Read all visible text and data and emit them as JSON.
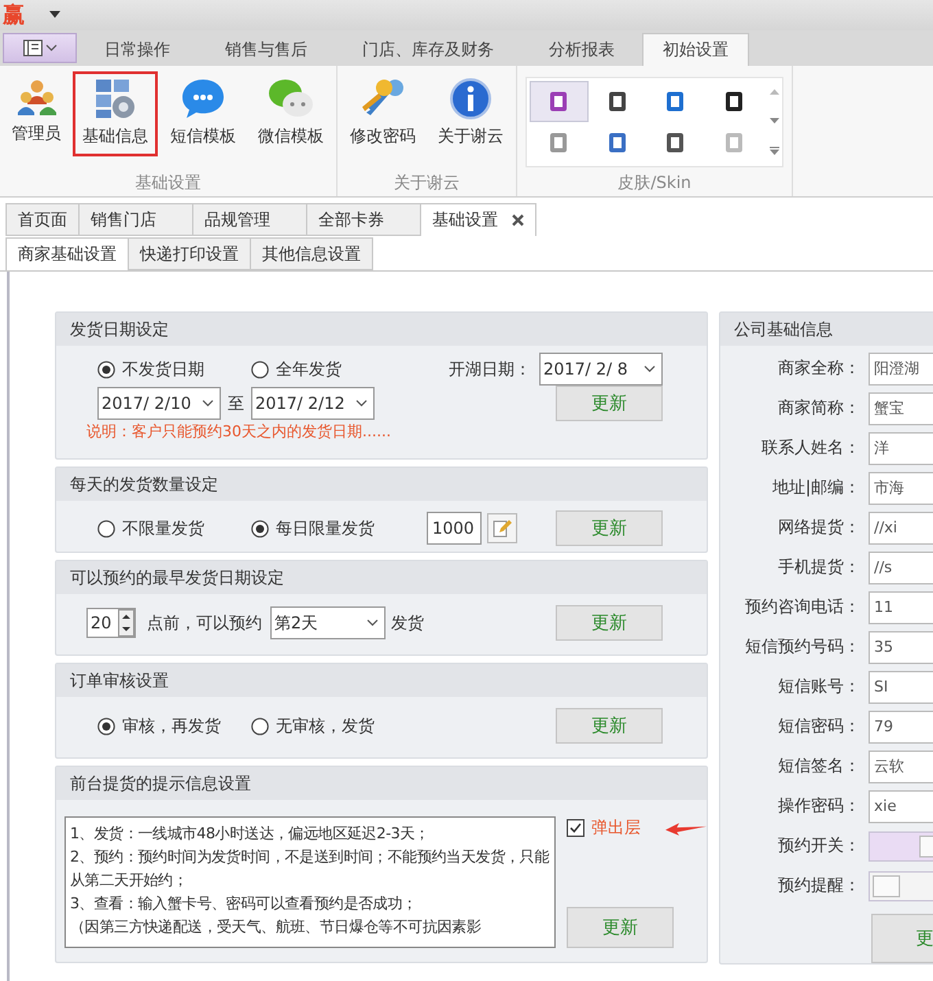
{
  "titlebar": {
    "logo": "赢"
  },
  "ribbon_tabs": [
    {
      "label": "日常操作",
      "selected": false
    },
    {
      "label": "销售与售后",
      "selected": false
    },
    {
      "label": "门店、库存及财务",
      "selected": false
    },
    {
      "label": "分析报表",
      "selected": false
    },
    {
      "label": "初始设置",
      "selected": true
    }
  ],
  "ribbon_groups": [
    {
      "title": "基础设置",
      "kind": "buttons",
      "buttons": [
        {
          "label": "管理员",
          "highlighted": false
        },
        {
          "label": "基础信息",
          "highlighted": true
        },
        {
          "label": "短信模板",
          "highlighted": false
        },
        {
          "label": "微信模板",
          "highlighted": false
        }
      ]
    },
    {
      "title": "关于谢云",
      "kind": "buttons",
      "buttons": [
        {
          "label": "修改密码",
          "highlighted": false
        },
        {
          "label": "关于谢云",
          "highlighted": false
        }
      ]
    },
    {
      "title": "皮肤/Skin",
      "kind": "gallery",
      "skins": [
        {
          "selected": true,
          "color": "#9b3fb5"
        },
        {
          "selected": false,
          "color": "#444444"
        },
        {
          "selected": false,
          "color": "#1e6fd0"
        },
        {
          "selected": false,
          "color": "#222222"
        },
        {
          "selected": false,
          "color": "#999999"
        },
        {
          "selected": false,
          "color": "#3a6fc4"
        },
        {
          "selected": false,
          "color": "#555555"
        },
        {
          "selected": false,
          "color": "#bbbbbb"
        }
      ]
    }
  ],
  "doc_tabs": [
    {
      "label": "首页面",
      "selected": false,
      "closable": false
    },
    {
      "label": "销售门店",
      "selected": false,
      "closable": false
    },
    {
      "label": "品规管理",
      "selected": false,
      "closable": false
    },
    {
      "label": "全部卡券",
      "selected": false,
      "closable": false
    },
    {
      "label": "基础设置",
      "selected": true,
      "closable": true
    }
  ],
  "sub_tabs": [
    {
      "label": "商家基础设置",
      "selected": true
    },
    {
      "label": "快递打印设置",
      "selected": false
    },
    {
      "label": "其他信息设置",
      "selected": false
    }
  ],
  "ship_date": {
    "title": "发货日期设定",
    "options": [
      {
        "label": "不发货日期",
        "selected": true
      },
      {
        "label": "全年发货",
        "selected": false
      }
    ],
    "from": "2017/  2/10",
    "to_label": "至",
    "to": "2017/  2/12",
    "open_label": "开湖日期：",
    "open_date": "2017/  2/  8",
    "note": "说明：客户只能预约30天之内的发货日期......",
    "button": "更新"
  },
  "daily_quantity": {
    "title": "每天的发货数量设定",
    "options": [
      {
        "label": "不限量发货",
        "selected": false
      },
      {
        "label": "每日限量发货",
        "selected": true
      }
    ],
    "limit": "1000",
    "button": "更新"
  },
  "earliest": {
    "title": "可以预约的最早发货日期设定",
    "hour": "20",
    "before_label": "点前，可以预约",
    "day": "第2天",
    "after_label": "发货",
    "button": "更新"
  },
  "review": {
    "title": "订单审核设置",
    "options": [
      {
        "label": "审核，再发货",
        "selected": true
      },
      {
        "label": "无审核，发货",
        "selected": false
      }
    ],
    "button": "更新"
  },
  "notice": {
    "title": "前台提货的提示信息设置",
    "lines": [
      "1、发货：一线城市48小时送达，偏远地区延迟2-3天；",
      "2、预约：预约时间为发货时间，不是送到时间；不能预约当天发货，只能从第二天开始约；",
      "3、查看：输入蟹卡号、密码可以查看预约是否成功；",
      "（因第三方快递配送，受天气、航班、节日爆仓等不可抗因素影"
    ],
    "popup": {
      "label": "弹出层",
      "checked": true
    },
    "button": "更新"
  },
  "company": {
    "title": "公司基础信息",
    "fields": [
      {
        "label": "商家全称：",
        "value": "阳澄湖",
        "kind": "text"
      },
      {
        "label": "商家简称：",
        "value": "蟹宝",
        "kind": "text"
      },
      {
        "label": "联系人姓名：",
        "value": "洋",
        "kind": "text"
      },
      {
        "label": "地址|邮编：",
        "value": "市海",
        "kind": "text"
      },
      {
        "label": "网络提货：",
        "value": "//xi",
        "kind": "text"
      },
      {
        "label": "手机提货：",
        "value": "//s",
        "kind": "text"
      },
      {
        "label": "预约咨询电话：",
        "value": "11",
        "kind": "text"
      },
      {
        "label": "短信预约号码：",
        "value": "35",
        "kind": "text"
      },
      {
        "label": "短信账号：",
        "value": "SI",
        "kind": "text"
      },
      {
        "label": "短信密码：",
        "value": "79",
        "kind": "text"
      },
      {
        "label": "短信签名：",
        "value": "云软",
        "kind": "text"
      },
      {
        "label": "操作密码：",
        "value": "xie",
        "kind": "text"
      },
      {
        "label": "预约开关：",
        "on": true,
        "kind": "toggle"
      },
      {
        "label": "预约提醒：",
        "on": false,
        "kind": "toggle"
      }
    ],
    "button": "更"
  }
}
